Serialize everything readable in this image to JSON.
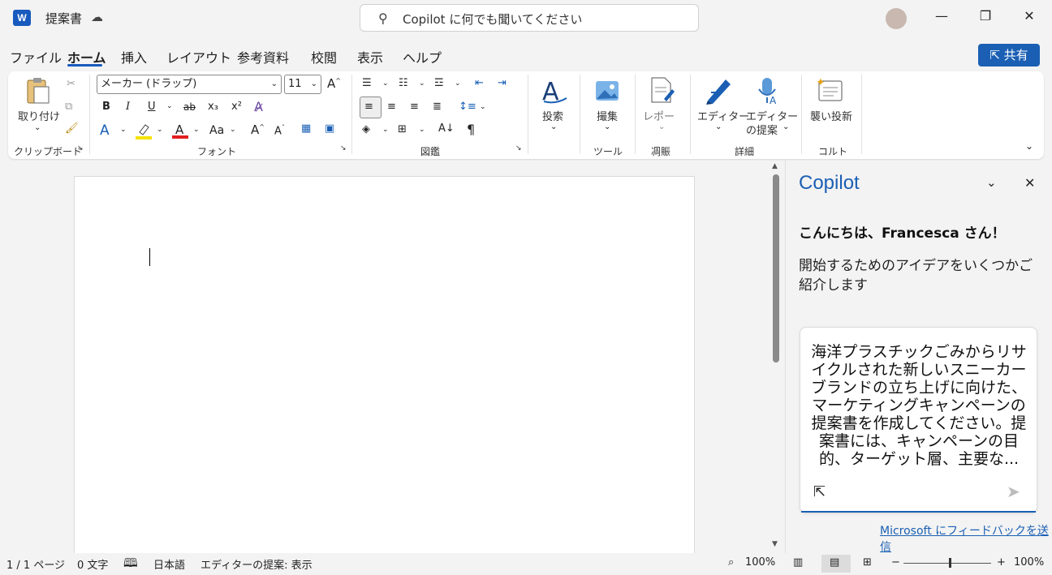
{
  "titlebar": {
    "app_logo": "W",
    "doc_title": "提案書",
    "search_placeholder": "Copilot に何でも聞いてください",
    "minimize": "—",
    "restore": "❐",
    "close": "✕"
  },
  "menu": {
    "items": [
      "ファイル",
      "ホーム",
      "挿入",
      "レイアウト",
      "参考資料",
      "校閲",
      "表示",
      "ヘルプ"
    ],
    "active_index": 1,
    "share_label": "共有"
  },
  "ribbon": {
    "clipboard": {
      "paste_label": "取り付け",
      "group_label": "クリップボード"
    },
    "font": {
      "font_name": "メーカー (ドラップ)",
      "font_size": "11",
      "bold": "B",
      "italic": "I",
      "underline": "U",
      "strike": "ab",
      "subscript": "x₃",
      "superscript": "x²",
      "change_case": "Aa",
      "group_label": "フォント"
    },
    "paragraph": {
      "pilcrow": "¶",
      "group_label": "図鑑"
    },
    "styles": {
      "label": "投索"
    },
    "tools": {
      "label": "撮集",
      "group_label": "ツール"
    },
    "reuse": {
      "label": "レポー",
      "group_label": "凋賑"
    },
    "editor": {
      "label1": "エディター",
      "label2a": "エディター",
      "label2b": "の提案",
      "group_label": "詳細"
    },
    "addin": {
      "label": "襲い投新",
      "group_label": "コルト"
    }
  },
  "copilot": {
    "title": "Copilot",
    "greeting": "こんにちは、Francesca さん！",
    "subtitle": "開始するためのアイデアをいくつかご紹介します",
    "prompt": "海洋プラスチックごみからリサイクルされた新しいスニーカーブランドの立ち上げに向けた、マーケティングキャンペーンの提案書を作成してください。提案書には、キャンペーンの目的、ターゲット層、主要な...",
    "feedback": "Microsoft にフィードバックを送信"
  },
  "status": {
    "page": "1 / 1 ページ",
    "words": "0 文字",
    "language": "日本語",
    "editor": "エディターの提案: 表示",
    "focus_zoom": "100%",
    "zoom": "100%"
  },
  "colors": {
    "accent": "#1a5fb4",
    "brand": "#185abd"
  }
}
